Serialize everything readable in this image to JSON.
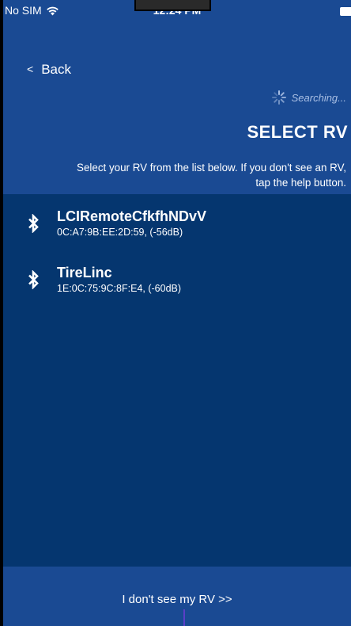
{
  "status_bar": {
    "carrier": "No SIM",
    "time": "12:24 PM"
  },
  "nav": {
    "back_label": "Back",
    "back_chevron": "<"
  },
  "search_status": {
    "label": "Searching..."
  },
  "page": {
    "title": "SELECT RV",
    "instructions": "Select your RV from the list below. If you don't see an RV, tap the help button."
  },
  "devices": [
    {
      "name": "LCIRemoteCfkfhNDvV",
      "detail": "0C:A7:9B:EE:2D:59, (-56dB)",
      "icon": "bluetooth-icon"
    },
    {
      "name": "TireLinc",
      "detail": "1E:0C:75:9C:8F:E4, (-60dB)",
      "icon": "bluetooth-icon"
    }
  ],
  "footer": {
    "help_label": "I don't see my RV >>"
  },
  "colors": {
    "header_bg": "#1a4a93",
    "list_bg": "#05366f",
    "searching_text": "#a9bfe4"
  }
}
